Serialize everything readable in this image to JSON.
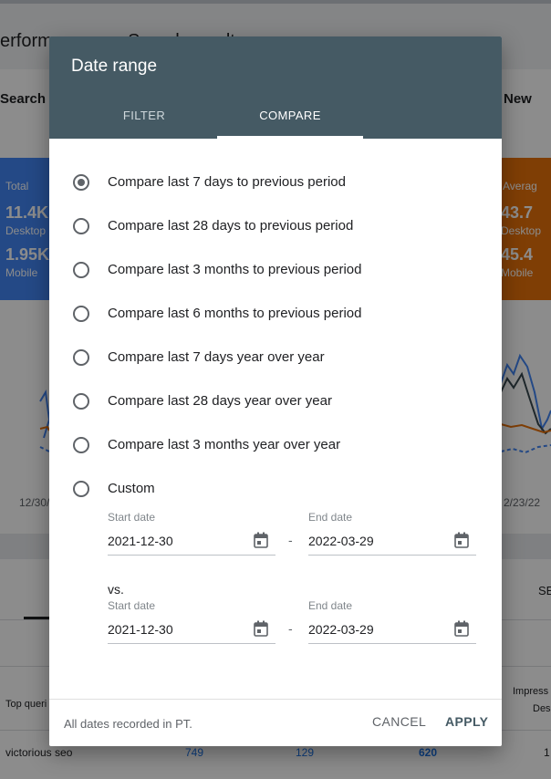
{
  "background": {
    "title_left": "erform",
    "title_right": "Search result",
    "search_type": "Search ty",
    "new_label": "New",
    "card_left": {
      "label": "Total",
      "value1": "11.4K",
      "sub1": "Desktop",
      "value2": "1.95K",
      "sub2": "Mobile"
    },
    "card_right": {
      "label": "Averag",
      "value1": "43.7",
      "sub1": "Desktop",
      "value2": "45.4",
      "sub2": "Mobile"
    },
    "axis_left": "12/30/",
    "axis_right": "2/23/22",
    "tab_right": "SE",
    "table": {
      "col_query": "Top queri",
      "col_impr": "Impress",
      "col_impr_sub": "Des",
      "row_query": "victorious seo",
      "row_v1": "749",
      "row_v2": "129",
      "row_v3": "620",
      "row_v4": "1"
    },
    "colors": {
      "blue": "#4285f4",
      "orange": "#e8710a",
      "dark": "#455a64"
    }
  },
  "dialog": {
    "title": "Date range",
    "tabs": [
      {
        "label": "FILTER",
        "selected": false
      },
      {
        "label": "COMPARE",
        "selected": true
      }
    ],
    "options": [
      {
        "label": "Compare last 7 days to previous period",
        "selected": true
      },
      {
        "label": "Compare last 28 days to previous period",
        "selected": false
      },
      {
        "label": "Compare last 3 months to previous period",
        "selected": false
      },
      {
        "label": "Compare last 6 months to previous period",
        "selected": false
      },
      {
        "label": "Compare last 7 days year over year",
        "selected": false
      },
      {
        "label": "Compare last 28 days year over year",
        "selected": false
      },
      {
        "label": "Compare last 3 months year over year",
        "selected": false
      },
      {
        "label": "Custom",
        "selected": false
      }
    ],
    "custom": {
      "range1": {
        "start_label": "Start date",
        "start_value": "2021-12-30",
        "end_label": "End date",
        "end_value": "2022-03-29"
      },
      "vs_label": "vs.",
      "range2": {
        "start_label": "Start date",
        "start_value": "2021-12-30",
        "end_label": "End date",
        "end_value": "2022-03-29"
      },
      "separator": "-"
    },
    "footer_note": "All dates recorded in PT.",
    "cancel_label": "CANCEL",
    "apply_label": "APPLY",
    "header_color": "#455a64"
  }
}
